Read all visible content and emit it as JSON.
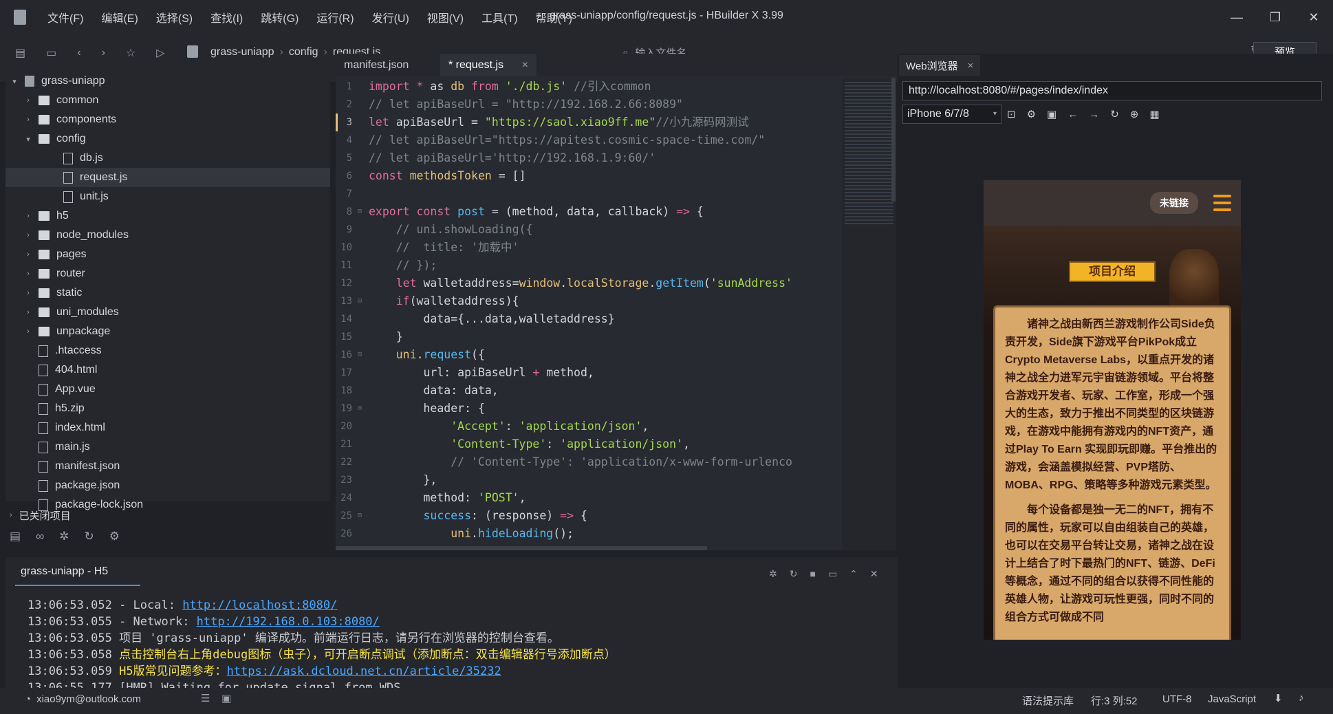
{
  "app": {
    "window_title": "grass-uniapp/config/request.js - HBuilder X 3.99",
    "menu": [
      "文件(F)",
      "编辑(E)",
      "选择(S)",
      "查找(I)",
      "跳转(G)",
      "运行(R)",
      "发行(U)",
      "视图(V)",
      "工具(T)",
      "帮助(Y)"
    ]
  },
  "toolbar": {
    "breadcrumb": [
      "grass-uniapp",
      "config",
      "request.js"
    ],
    "search_placeholder": "输入文件名",
    "preview_label": "预览"
  },
  "sidebar": {
    "project": "grass-uniapp",
    "items": [
      {
        "label": "common",
        "type": "folder",
        "level": 1
      },
      {
        "label": "components",
        "type": "folder",
        "level": 1
      },
      {
        "label": "config",
        "type": "folder",
        "level": 1,
        "open": true
      },
      {
        "label": "db.js",
        "type": "file",
        "level": 2
      },
      {
        "label": "request.js",
        "type": "file",
        "level": 2,
        "selected": true
      },
      {
        "label": "unit.js",
        "type": "file",
        "level": 2
      },
      {
        "label": "h5",
        "type": "folder",
        "level": 1
      },
      {
        "label": "node_modules",
        "type": "folder",
        "level": 1
      },
      {
        "label": "pages",
        "type": "folder",
        "level": 1
      },
      {
        "label": "router",
        "type": "folder",
        "level": 1
      },
      {
        "label": "static",
        "type": "folder",
        "level": 1
      },
      {
        "label": "uni_modules",
        "type": "folder",
        "level": 1
      },
      {
        "label": "unpackage",
        "type": "folder",
        "level": 1
      },
      {
        "label": ".htaccess",
        "type": "file",
        "level": 1
      },
      {
        "label": "404.html",
        "type": "html",
        "level": 1
      },
      {
        "label": "App.vue",
        "type": "vue",
        "level": 1
      },
      {
        "label": "h5.zip",
        "type": "file",
        "level": 1
      },
      {
        "label": "index.html",
        "type": "html",
        "level": 1
      },
      {
        "label": "main.js",
        "type": "file",
        "level": 1
      },
      {
        "label": "manifest.json",
        "type": "gear",
        "level": 1
      },
      {
        "label": "package.json",
        "type": "json",
        "level": 1
      },
      {
        "label": "package-lock.json",
        "type": "json",
        "level": 1
      }
    ],
    "closed_projects": "已关闭项目"
  },
  "editor": {
    "tabs": [
      "manifest.json",
      "* request.js"
    ],
    "lines": [
      [
        [
          "k",
          "import"
        ],
        [
          "t",
          " "
        ],
        [
          "k",
          "*"
        ],
        [
          "t",
          " as "
        ],
        [
          "p",
          "db"
        ],
        [
          "t",
          " "
        ],
        [
          "k",
          "from"
        ],
        [
          "t",
          " "
        ],
        [
          "s",
          "'./db.js'"
        ],
        [
          "t",
          " "
        ],
        [
          "c",
          "//引入common"
        ]
      ],
      [
        [
          "c",
          "// let apiBaseUrl = \"http://192.168.2.66:8089\""
        ]
      ],
      [
        [
          "k",
          "let"
        ],
        [
          "t",
          " apiBaseUrl = "
        ],
        [
          "s",
          "\"https://saol.xiao9ff.me\""
        ],
        [
          "c",
          "//小九源码网测试"
        ]
      ],
      [
        [
          "c",
          "// let apiBaseUrl=\"https://apitest.cosmic-space-time.com/\""
        ]
      ],
      [
        [
          "c",
          "// let apiBaseUrl='http://192.168.1.9:60/'"
        ]
      ],
      [
        [
          "k",
          "const"
        ],
        [
          "t",
          " "
        ],
        [
          "p",
          "methodsToken"
        ],
        [
          "t",
          " = []"
        ]
      ],
      [
        [
          "t",
          ""
        ]
      ],
      [
        [
          "k",
          "export"
        ],
        [
          "t",
          " "
        ],
        [
          "k",
          "const"
        ],
        [
          "t",
          " "
        ],
        [
          "f",
          "post"
        ],
        [
          "t",
          " = (method, data, callback) "
        ],
        [
          "k",
          "=>"
        ],
        [
          "t",
          " {"
        ]
      ],
      [
        [
          "t",
          "    "
        ],
        [
          "c",
          "// uni.showLoading({"
        ]
      ],
      [
        [
          "t",
          "    "
        ],
        [
          "c",
          "//  title: '加载中'"
        ]
      ],
      [
        [
          "t",
          "    "
        ],
        [
          "c",
          "// });"
        ]
      ],
      [
        [
          "t",
          "    "
        ],
        [
          "k",
          "let"
        ],
        [
          "t",
          " walletaddress="
        ],
        [
          "p",
          "window"
        ],
        [
          "t",
          "."
        ],
        [
          "p",
          "localStorage"
        ],
        [
          "t",
          "."
        ],
        [
          "f",
          "getItem"
        ],
        [
          "t",
          "("
        ],
        [
          "s",
          "'sunAddress'"
        ]
      ],
      [
        [
          "t",
          "    "
        ],
        [
          "k",
          "if"
        ],
        [
          "t",
          "(walletaddress){"
        ]
      ],
      [
        [
          "t",
          "        data={...data,walletaddress}"
        ]
      ],
      [
        [
          "t",
          "    }"
        ]
      ],
      [
        [
          "t",
          "    "
        ],
        [
          "p",
          "uni"
        ],
        [
          "t",
          "."
        ],
        [
          "f",
          "request"
        ],
        [
          "t",
          "({"
        ]
      ],
      [
        [
          "t",
          "        url: apiBaseUrl "
        ],
        [
          "k",
          "+"
        ],
        [
          "t",
          " method,"
        ]
      ],
      [
        [
          "t",
          "        data: data,"
        ]
      ],
      [
        [
          "t",
          "        header: {"
        ]
      ],
      [
        [
          "t",
          "            "
        ],
        [
          "s",
          "'Accept'"
        ],
        [
          "t",
          ": "
        ],
        [
          "s",
          "'application/json'"
        ],
        [
          "t",
          ","
        ]
      ],
      [
        [
          "t",
          "            "
        ],
        [
          "s",
          "'Content-Type'"
        ],
        [
          "t",
          ": "
        ],
        [
          "s",
          "'application/json'"
        ],
        [
          "t",
          ","
        ]
      ],
      [
        [
          "t",
          "            "
        ],
        [
          "c",
          "// 'Content-Type': 'application/x-www-form-urlenco"
        ]
      ],
      [
        [
          "t",
          "        },"
        ]
      ],
      [
        [
          "t",
          "        method: "
        ],
        [
          "s",
          "'POST'"
        ],
        [
          "t",
          ","
        ]
      ],
      [
        [
          "t",
          "        "
        ],
        [
          "f",
          "success"
        ],
        [
          "t",
          ": (response) "
        ],
        [
          "k",
          "=>"
        ],
        [
          "t",
          " {"
        ]
      ],
      [
        [
          "t",
          "            "
        ],
        [
          "p",
          "uni"
        ],
        [
          "t",
          "."
        ],
        [
          "f",
          "hideLoading"
        ],
        [
          "t",
          "();"
        ]
      ]
    ]
  },
  "browser": {
    "tab_label": "Web浏览器",
    "url": "http://localhost:8080/#/pages/index/index",
    "device": "iPhone 6/7/8",
    "phone": {
      "unlink": "未链接",
      "banner": "项目介绍",
      "paragraphs": [
        "诸神之战由新西兰游戏制作公司Side负责开发，Side旗下游戏平台PikPok成立Crypto Metaverse Labs，以重点开发的诸神之战全力进军元宇宙链游领域。平台将整合游戏开发者、玩家、工作室，形成一个强大的生态，致力于推出不同类型的区块链游戏，在游戏中能拥有游戏内的NFT资产，通过Play To Earn 实现即玩即赚。平台推出的游戏，会涵盖模拟经营、PVP塔防、MOBA、RPG、策略等多种游戏元素类型。",
        "每个设备都是独一无二的NFT，拥有不同的属性，玩家可以自由组装自己的英雄，也可以在交易平台转让交易，诸神之战在设计上结合了时下最热门的NFT、链游、DeFi等概念，通过不同的组合以获得不同性能的英雄人物，让游戏可玩性更强，同时不同的组合方式可做成不同"
      ]
    }
  },
  "console": {
    "title": "grass-uniapp - H5",
    "logs": [
      {
        "time": "13:06:53.052",
        "text": "  - Local:   ",
        "link": "http://localhost:8080/"
      },
      {
        "time": "13:06:53.055",
        "text": "  - Network: ",
        "link": "http://192.168.0.103:8080/"
      },
      {
        "time": "13:06:53.055",
        "text": "项目 'grass-uniapp' 编译成功。前端运行日志，请另行在浏览器的控制台查看。"
      },
      {
        "time": "13:06:53.058",
        "text": "点击控制台右上角debug图标（虫子），可开启断点调试（添加断点：双击编辑器行号添加断点）",
        "yellow": true
      },
      {
        "time": "13:06:53.059",
        "text": "H5版常见问题参考：",
        "link": "https://ask.dcloud.net.cn/article/35232",
        "yellow": true
      },
      {
        "time": "13:06:55.177",
        "text": "[HMR] Waiting for update signal from WDS..."
      }
    ]
  },
  "status": {
    "user": "xiao9ym@outlook.com",
    "hint": "语法提示库",
    "position": "行:3  列:52",
    "encoding": "UTF-8",
    "language": "JavaScript"
  }
}
